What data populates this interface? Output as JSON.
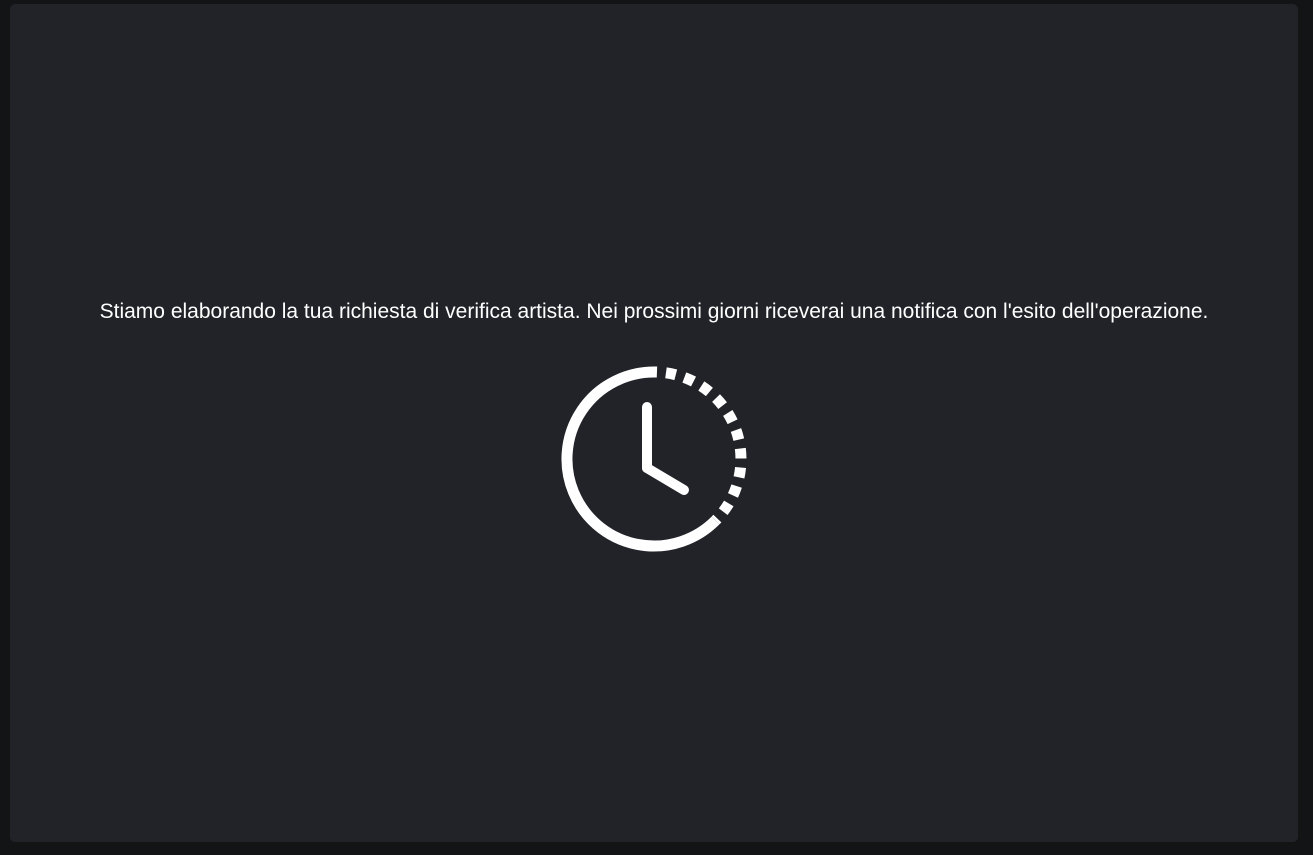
{
  "status": {
    "message": "Stiamo elaborando la tua richiesta di verifica artista. Nei prossimi giorni riceverai una notifica con l'esito dell'operazione.",
    "icon": "pending-clock-icon",
    "text_color": "#ffffff",
    "panel_color": "#212328",
    "background_color": "#131416"
  }
}
